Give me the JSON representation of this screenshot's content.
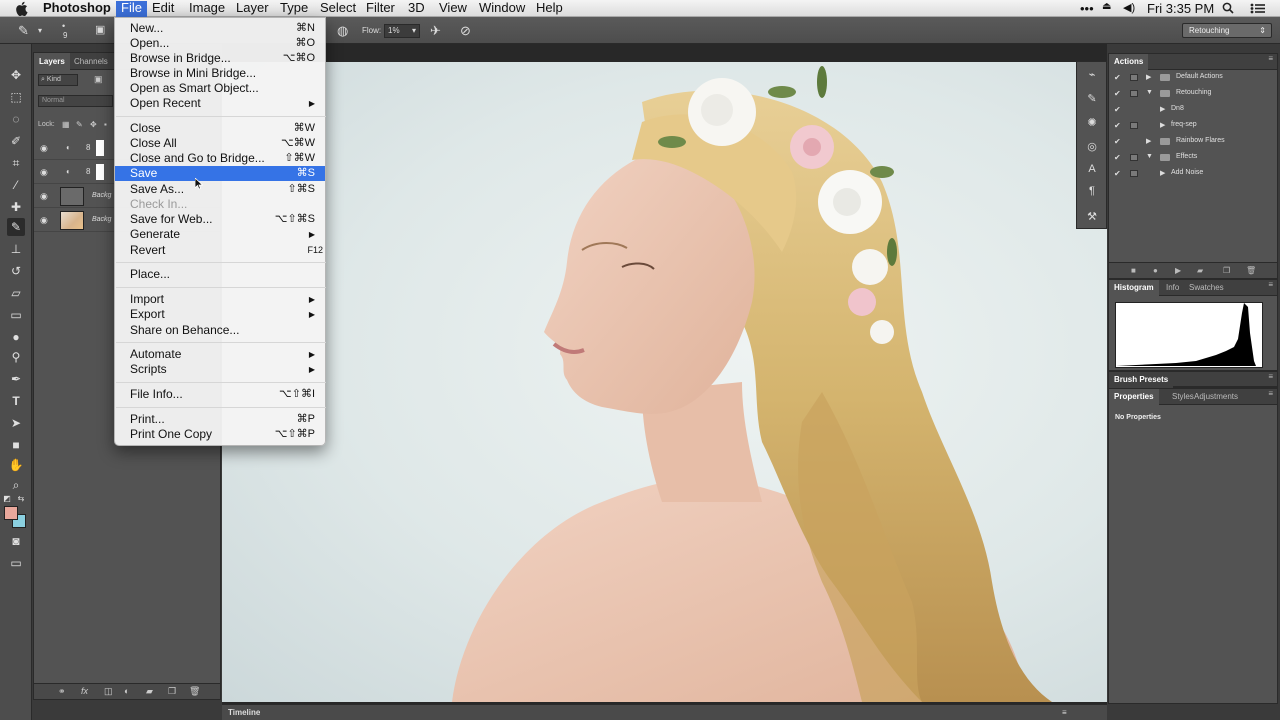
{
  "menubar": {
    "app": "Photoshop",
    "items": [
      "File",
      "Edit",
      "Image",
      "Layer",
      "Type",
      "Select",
      "Filter",
      "3D",
      "View",
      "Window",
      "Help"
    ],
    "clock": "Fri 3:35 PM"
  },
  "options": {
    "size": "9",
    "flow_label": "Flow:",
    "flow_value": "1%",
    "workspace": "Retouching"
  },
  "layers_panel": {
    "tabs": [
      "Layers",
      "Channels"
    ],
    "kind": "Kind",
    "blend": "Normal",
    "lock_label": "Lock:",
    "layers": [
      {
        "name": ""
      },
      {
        "name": ""
      },
      {
        "name": "Backg"
      },
      {
        "name": "Backg"
      }
    ]
  },
  "file_menu": {
    "items": [
      {
        "label": "New...",
        "shortcut": "⌘N"
      },
      {
        "label": "Open...",
        "shortcut": "⌘O"
      },
      {
        "label": "Browse in Bridge...",
        "shortcut": "⌥⌘O"
      },
      {
        "label": "Browse in Mini Bridge...",
        "shortcut": ""
      },
      {
        "label": "Open as Smart Object...",
        "shortcut": ""
      },
      {
        "label": "Open Recent",
        "shortcut": "",
        "submenu": true
      },
      {
        "label": "Close",
        "shortcut": "⌘W"
      },
      {
        "label": "Close All",
        "shortcut": "⌥⌘W"
      },
      {
        "label": "Close and Go to Bridge...",
        "shortcut": "⇧⌘W"
      },
      {
        "label": "Save",
        "shortcut": "⌘S",
        "highlighted": true
      },
      {
        "label": "Save As...",
        "shortcut": "⇧⌘S"
      },
      {
        "label": "Check In...",
        "shortcut": "",
        "disabled": true
      },
      {
        "label": "Save for Web...",
        "shortcut": "⌥⇧⌘S"
      },
      {
        "label": "Generate",
        "shortcut": "",
        "submenu": true
      },
      {
        "label": "Revert",
        "shortcut": "F12"
      },
      {
        "label": "Place...",
        "shortcut": ""
      },
      {
        "label": "Import",
        "shortcut": "",
        "submenu": true
      },
      {
        "label": "Export",
        "shortcut": "",
        "submenu": true
      },
      {
        "label": "Share on Behance...",
        "shortcut": ""
      },
      {
        "label": "Automate",
        "shortcut": "",
        "submenu": true
      },
      {
        "label": "Scripts",
        "shortcut": "",
        "submenu": true
      },
      {
        "label": "File Info...",
        "shortcut": "⌥⇧⌘I"
      },
      {
        "label": "Print...",
        "shortcut": "⌘P"
      },
      {
        "label": "Print One Copy",
        "shortcut": "⌥⇧⌘P"
      }
    ]
  },
  "actions_panel": {
    "tab": "Actions",
    "rows": [
      {
        "name": "Default Actions",
        "level": 0,
        "type": "set",
        "expanded": false
      },
      {
        "name": "Retouching",
        "level": 0,
        "type": "set",
        "expanded": true
      },
      {
        "name": "Dn8",
        "level": 1,
        "type": "action"
      },
      {
        "name": "freq-sep",
        "level": 1,
        "type": "action"
      },
      {
        "name": "Rainbow Flares",
        "level": 0,
        "type": "set",
        "expanded": false
      },
      {
        "name": "Effects",
        "level": 0,
        "type": "set",
        "expanded": true
      },
      {
        "name": "Add Noise",
        "level": 1,
        "type": "action"
      }
    ]
  },
  "histogram_panel": {
    "tabs": [
      "Histogram",
      "Info",
      "Swatches"
    ]
  },
  "brush_presets": {
    "title": "Brush Presets"
  },
  "properties_panel": {
    "tabs": [
      "Properties",
      "Styles",
      "Adjustments"
    ],
    "content": "No Properties"
  },
  "timeline": {
    "label": "Timeline"
  },
  "colors": {
    "foreground": "#e9a89c",
    "background": "#8bd0e0",
    "menu_highlight": "#3573e6"
  }
}
